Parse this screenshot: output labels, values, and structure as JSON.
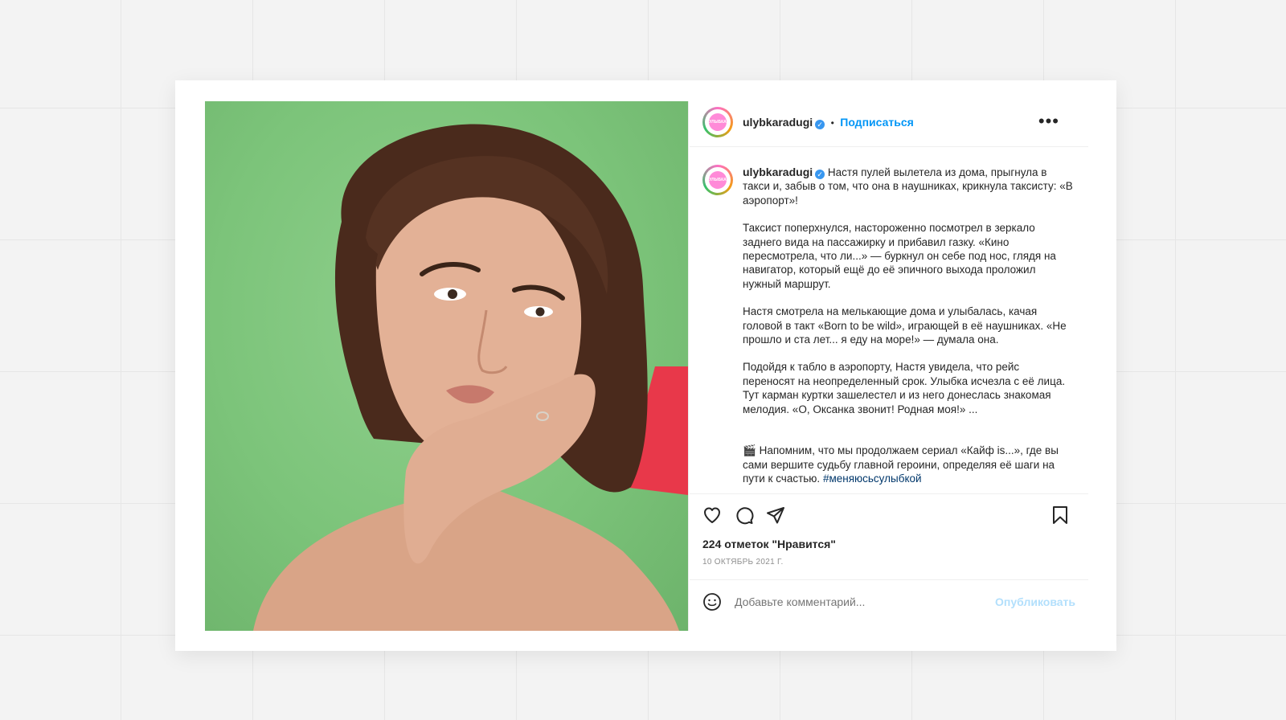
{
  "post": {
    "username": "ulybkaradugi",
    "verified_icon": "✓",
    "follow_label": "Подписаться",
    "dot": "•",
    "more_label": "•••",
    "avatar_text": "УЛЫБКА РАДУГИ",
    "caption": {
      "username": "ulybkaradugi",
      "p1": "Настя пулей вылетела из дома, прыгнула в такси и, забыв о том, что она в наушниках, крикнула таксисту: «В аэропорт»!",
      "p2": "Таксист поперхнулся, настороженно посмотрел в зеркало заднего вида на пассажирку и прибавил газку. «Кино пересмотрела, что ли...» — буркнул он себе под нос, глядя на навигатор, который ещё до её эпичного выхода проложил нужный маршрут.",
      "p3": "Настя смотрела на мелькающие дома и улыбалась, качая головой в такт «Born to be wild», играющей в её наушниках. «Не прошло и ста лет... я еду на море!» — думала она.",
      "p4": "Подойдя к табло в аэропорту, Настя увидела, что рейс переносят на неопределенный срок. Улыбка исчезла с её лица. Тут карман куртки зашелестел и из него донеслась знакомая мелодия. «О, Оксанка звонит! Родная моя!» ...",
      "p5_emoji": "🎬",
      "p5": "Напомним, что мы продолжаем сериал «Кайф is...», где вы сами вершите судьбу главной героини, определяя её шаги на пути к счастью.",
      "hashtag": "#меняюсьсулыбкой"
    },
    "likes": "224 отметок \"Нравится\"",
    "date": "10 ОКТЯБРЬ 2021 Г.",
    "comment_placeholder": "Добавьте комментарий...",
    "publish_label": "Опубликовать",
    "icons": [
      "heart-icon",
      "comment-icon",
      "share-icon",
      "bookmark-icon",
      "emoji-icon"
    ],
    "colors": {
      "accent": "#0095f6",
      "verified": "#3897f0",
      "photo_bg": "#7cc47a",
      "publish_disabled": "#b2dffc"
    }
  }
}
